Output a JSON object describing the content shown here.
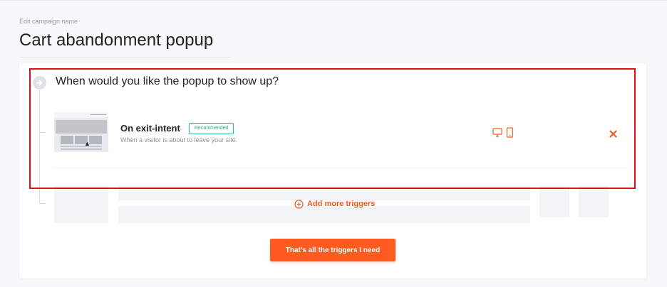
{
  "campaign": {
    "label": "Edit campaign name",
    "name": "Cart abandonment popup"
  },
  "question": "When would you like the popup to show up?",
  "trigger": {
    "title": "On exit-intent",
    "badge": "Recommended",
    "description": "When a visitor is about to leave your site.",
    "devices": [
      "desktop-icon",
      "mobile-icon"
    ],
    "remove_icon": "close-icon"
  },
  "add_more_label": "Add more triggers",
  "cta_label": "That's all the triggers I need",
  "colors": {
    "accent": "#ff5a1f",
    "badge_green": "#2cc07a",
    "highlight_red": "#e0101a"
  }
}
